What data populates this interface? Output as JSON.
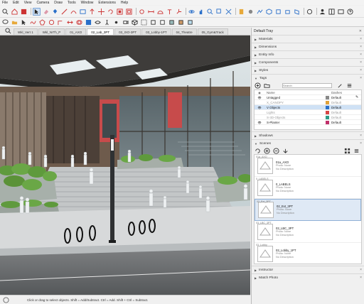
{
  "menu": [
    "File",
    "Edit",
    "View",
    "Camera",
    "Draw",
    "Tools",
    "Window",
    "Extensions",
    "Help"
  ],
  "tabs": [
    "Wkl_Vert 1",
    "Wkl_NrTh_P",
    "01_AXO",
    "02_Lab_3PT",
    "03_IXO-3PT",
    "03_Lobby-1PT",
    "04_Theatre",
    "05_Gym&Track"
  ],
  "active_tab_index": 3,
  "status": {
    "text": "Click or drag to select objects. Shift = Add/Subtract. Ctrl = Add. Shift + Ctrl = Subtract."
  },
  "tray": {
    "title": "Default Tray",
    "sections_top": [
      "Materials",
      "Dimensions",
      "Entity Info",
      "Components",
      "Styles"
    ],
    "tags_label": "Tags",
    "tags_search_placeholder": "Search",
    "tags_columns": {
      "name": "Name",
      "dashes": "Dashes"
    },
    "tags": [
      {
        "name": "Untagged",
        "dashes": "Default",
        "color": "#888888",
        "selected": false
      },
      {
        "name": "X_CANOPY",
        "dashes": "Default",
        "color": "#e0a23a",
        "selected": false
      },
      {
        "name": "V Objects",
        "dashes": "Default",
        "color": "#2a6fc9",
        "selected": true
      },
      {
        "name": "Lights",
        "dashes": "Default",
        "color": "#d64545",
        "selected": false
      },
      {
        "name": "S-3D-Objects",
        "dashes": "Default",
        "color": "#2c9a86",
        "selected": false
      },
      {
        "name": "S-Planter",
        "dashes": "Default",
        "color": "#c0306a",
        "selected": false
      }
    ],
    "shadows_label": "Shadows",
    "scenes_label": "Scenes",
    "scenes": [
      {
        "title": "01a_AXO",
        "photo": "Photo: None",
        "desc": "No Description",
        "label": "01a_AXO"
      },
      {
        "title": "0_LABELS",
        "photo": "Photo: None",
        "desc": "No Description",
        "label": "0_LABELS"
      },
      {
        "title": "02_Ext_3PT",
        "photo": "Photo: None",
        "desc": "No Description",
        "label": "02_Ext_3PT"
      },
      {
        "title": "03_LBC_3PT",
        "photo": "Photo: None",
        "desc": "No Description",
        "label": "03_LBC_3PT"
      },
      {
        "title": "03_Lobby_1PT",
        "photo": "Photo: None",
        "desc": "No Description",
        "label": "03_Lobby"
      }
    ],
    "selected_scene_index": 2,
    "sections_bottom": [
      "Instructor",
      "Match Photo"
    ]
  }
}
